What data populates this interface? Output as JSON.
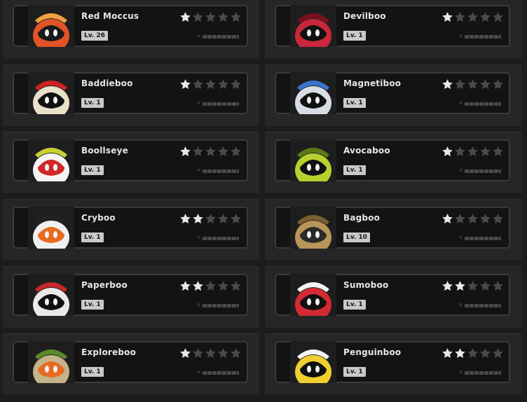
{
  "cards": [
    {
      "name": "Red Moccus",
      "level": "Lv. 26",
      "stars": 1,
      "max_stars": 5,
      "icon": "red-moccus-portrait",
      "colors": {
        "body": "#e25427",
        "face": "#1a1a1a",
        "accent": "#f0a040"
      }
    },
    {
      "name": "Devilboo",
      "level": "Lv. 1",
      "stars": 1,
      "max_stars": 5,
      "icon": "devilboo-portrait",
      "colors": {
        "body": "#c8283a",
        "face": "#111111",
        "accent": "#7a1020"
      }
    },
    {
      "name": "Baddieboo",
      "level": "Lv. 1",
      "stars": 1,
      "max_stars": 5,
      "icon": "baddieboo-portrait",
      "colors": {
        "body": "#e8e0c8",
        "face": "#111111",
        "accent": "#d02020"
      }
    },
    {
      "name": "Magnetiboo",
      "level": "Lv. 1",
      "stars": 1,
      "max_stars": 5,
      "icon": "magnetiboo-portrait",
      "colors": {
        "body": "#d8dde4",
        "face": "#111111",
        "accent": "#3a74d0"
      }
    },
    {
      "name": "Boollseye",
      "level": "Lv. 1",
      "stars": 1,
      "max_stars": 5,
      "icon": "boollseye-portrait",
      "colors": {
        "body": "#f4f4f4",
        "face": "#d02828",
        "accent": "#c8d030"
      }
    },
    {
      "name": "Avocaboo",
      "level": "Lv. 1",
      "stars": 1,
      "max_stars": 5,
      "icon": "avocaboo-portrait",
      "colors": {
        "body": "#b8d030",
        "face": "#111111",
        "accent": "#5a7a18"
      }
    },
    {
      "name": "Cryboo",
      "level": "Lv. 1",
      "stars": 2,
      "max_stars": 5,
      "icon": "cryboo-portrait",
      "colors": {
        "body": "#f0f0f0",
        "face": "#e86a20",
        "accent": "#222222"
      }
    },
    {
      "name": "Bagboo",
      "level": "Lv. 10",
      "stars": 1,
      "max_stars": 5,
      "icon": "bagboo-portrait",
      "colors": {
        "body": "#b8955a",
        "face": "#2a2a2a",
        "accent": "#7a5f30"
      }
    },
    {
      "name": "Paperboo",
      "level": "Lv. 1",
      "stars": 2,
      "max_stars": 5,
      "icon": "paperboo-portrait",
      "colors": {
        "body": "#eaeaea",
        "face": "#111111",
        "accent": "#c82828"
      }
    },
    {
      "name": "Sumoboo",
      "level": "Lv. 1",
      "stars": 2,
      "max_stars": 5,
      "icon": "sumoboo-portrait",
      "colors": {
        "body": "#d42a34",
        "face": "#111111",
        "accent": "#f4f4f4"
      }
    },
    {
      "name": "Exploreboo",
      "level": "Lv. 1",
      "stars": 1,
      "max_stars": 5,
      "icon": "exploreboo-portrait",
      "colors": {
        "body": "#c4b48a",
        "face": "#e86a20",
        "accent": "#5a8a2a"
      }
    },
    {
      "name": "Penguinboo",
      "level": "Lv. 1",
      "stars": 2,
      "max_stars": 5,
      "icon": "penguinboo-portrait",
      "colors": {
        "body": "#f0d030",
        "face": "#111111",
        "accent": "#f4f4f4"
      }
    }
  ],
  "theme": {
    "star_filled": "#e8e8e8",
    "star_empty": "#4a4a4a"
  }
}
